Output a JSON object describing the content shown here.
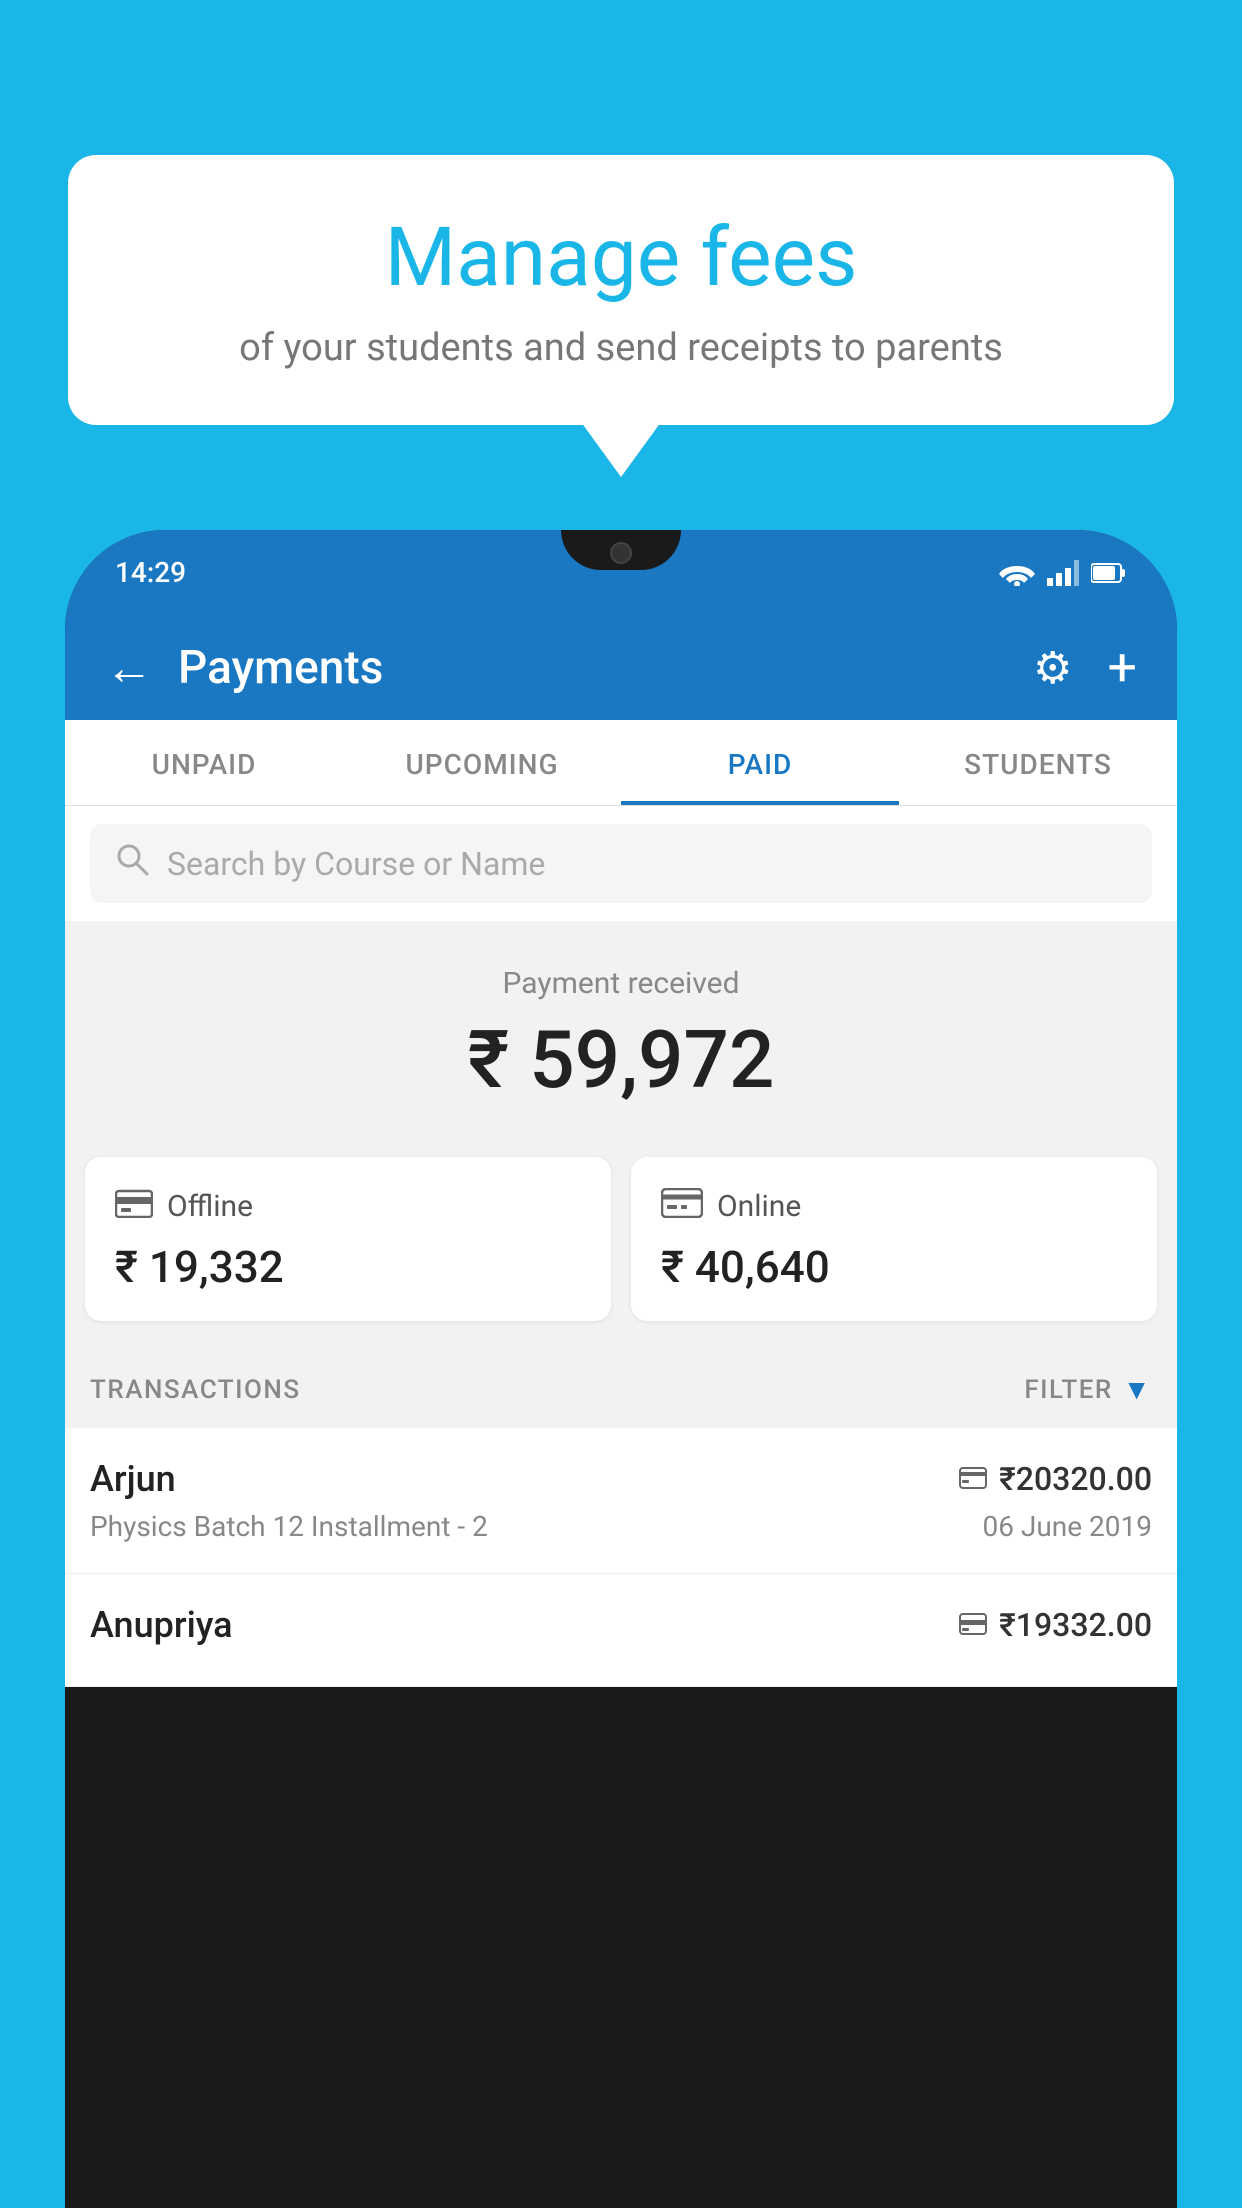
{
  "background_color": "#1ab6e8",
  "speech_bubble": {
    "title": "Manage fees",
    "subtitle": "of your students and send receipts to parents"
  },
  "status_bar": {
    "time": "14:29"
  },
  "app_bar": {
    "title": "Payments",
    "back_label": "←",
    "plus_label": "+",
    "gear_label": "⚙"
  },
  "tabs": [
    {
      "label": "UNPAID",
      "active": false
    },
    {
      "label": "UPCOMING",
      "active": false
    },
    {
      "label": "PAID",
      "active": true
    },
    {
      "label": "STUDENTS",
      "active": false
    }
  ],
  "search": {
    "placeholder": "Search by Course or Name"
  },
  "payment_received": {
    "label": "Payment received",
    "amount": "₹ 59,972"
  },
  "payment_cards": [
    {
      "type": "Offline",
      "amount": "₹ 19,332",
      "icon": "offline"
    },
    {
      "type": "Online",
      "amount": "₹ 40,640",
      "icon": "online"
    }
  ],
  "transactions_header": {
    "label": "TRANSACTIONS",
    "filter_label": "FILTER"
  },
  "transactions": [
    {
      "name": "Arjun",
      "course": "Physics Batch 12 Installment - 2",
      "amount": "₹20320.00",
      "date": "06 June 2019",
      "type": "online"
    },
    {
      "name": "Anupriya",
      "course": "",
      "amount": "₹19332.00",
      "date": "",
      "type": "offline"
    }
  ]
}
